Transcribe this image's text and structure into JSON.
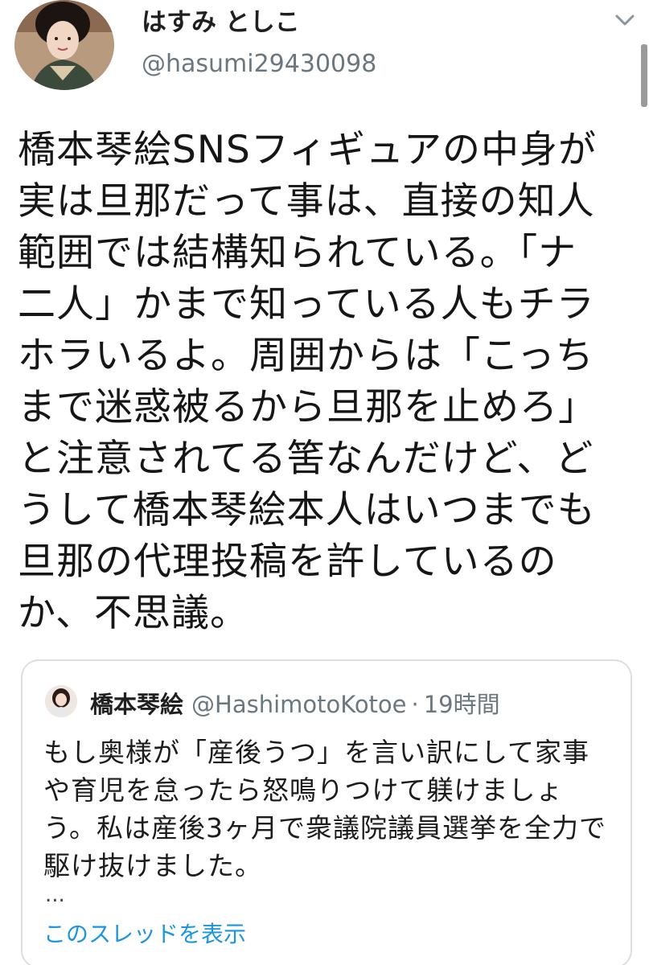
{
  "tweet": {
    "author": {
      "display_name": "はすみ としこ",
      "handle": "@hasumi29430098"
    },
    "menu_icon": "chevron-down-icon",
    "lines": [
      "橋本琴絵SNSフィギュアの中身が",
      "実は旦那だって事は、直接の知人",
      "範囲では結構知られている。「ナ",
      "二人」かまで知っている人もチラ",
      "ホラいるよ。周囲からは「こっち",
      "まで迷惑被るから旦那を止めろ」",
      "と注意されてる筈なんだけど、ど",
      "うして橋本琴絵本人はいつまでも",
      "旦那の代理投稿を許しているの",
      "か、不思議。"
    ]
  },
  "quoted_tweet": {
    "author_name": "橋本琴絵",
    "handle": "@HashimotoKotoe",
    "separator": "·",
    "time": "19時間",
    "lines": [
      "もし奥様が「産後うつ」を言い訳にして家事",
      "や育児を怠ったら怒鳴りつけて躾けましょ",
      "う。私は産後3ヶ月で衆議院議員選挙を全力で",
      "駆け抜けました。"
    ],
    "ellipsis": "...",
    "show_thread": "このスレッドを表示"
  },
  "colors": {
    "link": "#1b95e0",
    "secondary_text": "#6b7780",
    "card_border": "#d9dfe3"
  }
}
